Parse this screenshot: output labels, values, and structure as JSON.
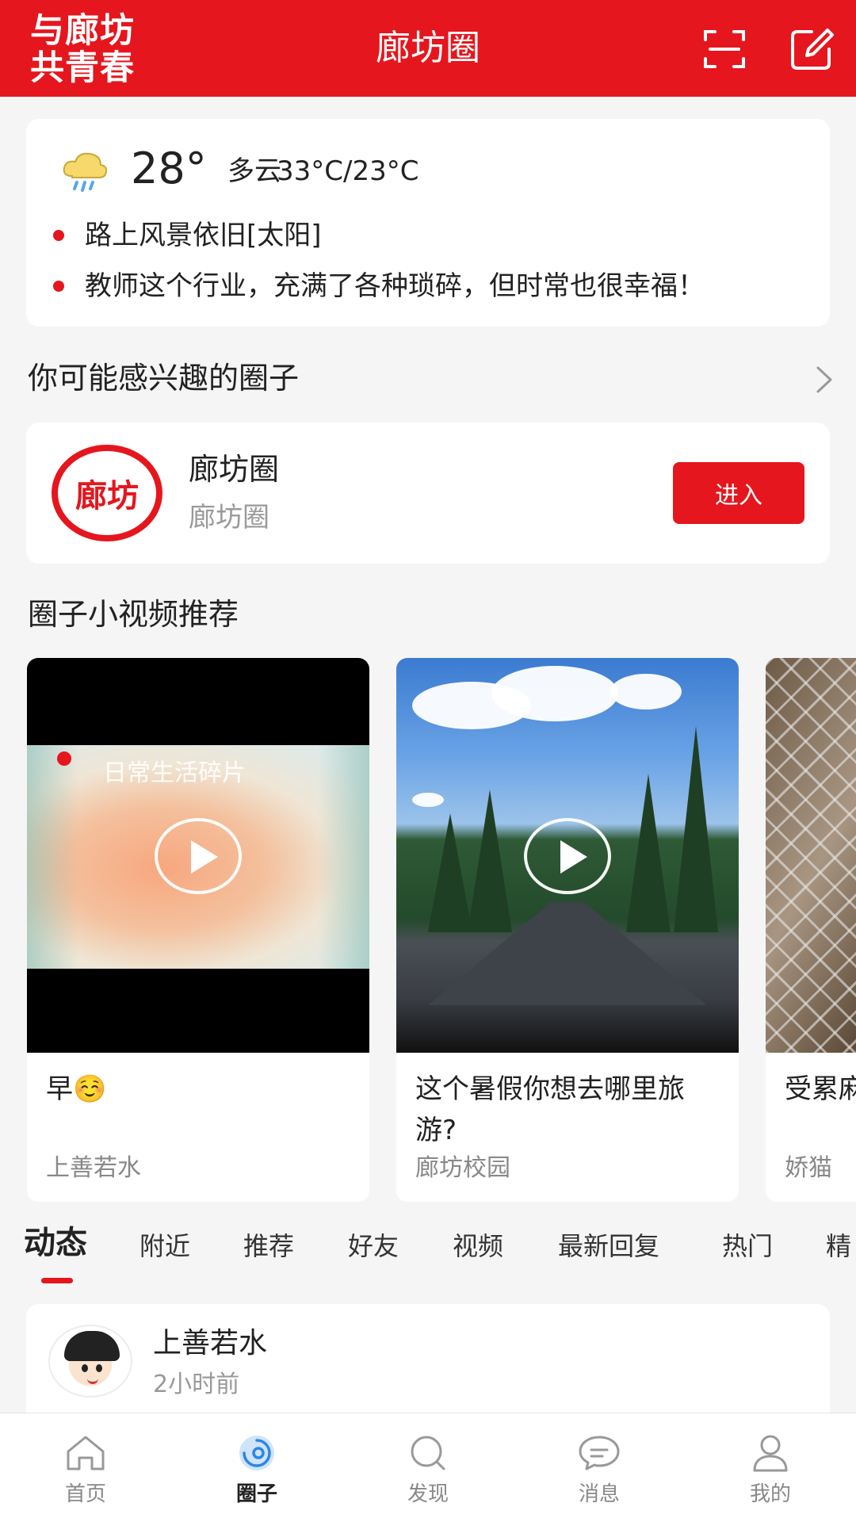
{
  "header": {
    "logo_line1": "与廊坊",
    "logo_line2": "共青春",
    "title": "廊坊圈",
    "icons": [
      "scan-icon",
      "edit-icon"
    ]
  },
  "weather": {
    "icon": "cloud-rain-icon",
    "temp": "28°",
    "condition": "多云",
    "range": "33°C/23°C",
    "news": [
      "路上风景依旧[太阳]",
      "教师这个行业，充满了各种琐碎，但时常也很幸福！"
    ]
  },
  "interest": {
    "title": "你可能感兴趣的圈子",
    "circle": {
      "logo_text": "廊坊",
      "name": "廊坊圈",
      "sub": "廊坊圈",
      "button": "进入"
    }
  },
  "videos": {
    "title": "圈子小视频推荐",
    "items": [
      {
        "thumb_caption": "日常生活碎片",
        "title": "早☺️",
        "author": "上善若水"
      },
      {
        "title": "这个暑假你想去哪里旅游?",
        "author": "廊坊校园"
      },
      {
        "title": "受累麻 [抱拳",
        "author": "娇猫"
      }
    ]
  },
  "tabs": [
    "动态",
    "附近",
    "推荐",
    "好友",
    "视频",
    "最新回复",
    "热门",
    "精"
  ],
  "post": {
    "user": "上善若水",
    "time": "2小时前"
  },
  "nav": [
    {
      "label": "首页",
      "icon": "home-icon"
    },
    {
      "label": "圈子",
      "icon": "circle-icon"
    },
    {
      "label": "发现",
      "icon": "discover-icon"
    },
    {
      "label": "消息",
      "icon": "message-icon"
    },
    {
      "label": "我的",
      "icon": "profile-icon"
    }
  ],
  "colors": {
    "accent": "#e5161d",
    "background": "#f5f5f5"
  }
}
